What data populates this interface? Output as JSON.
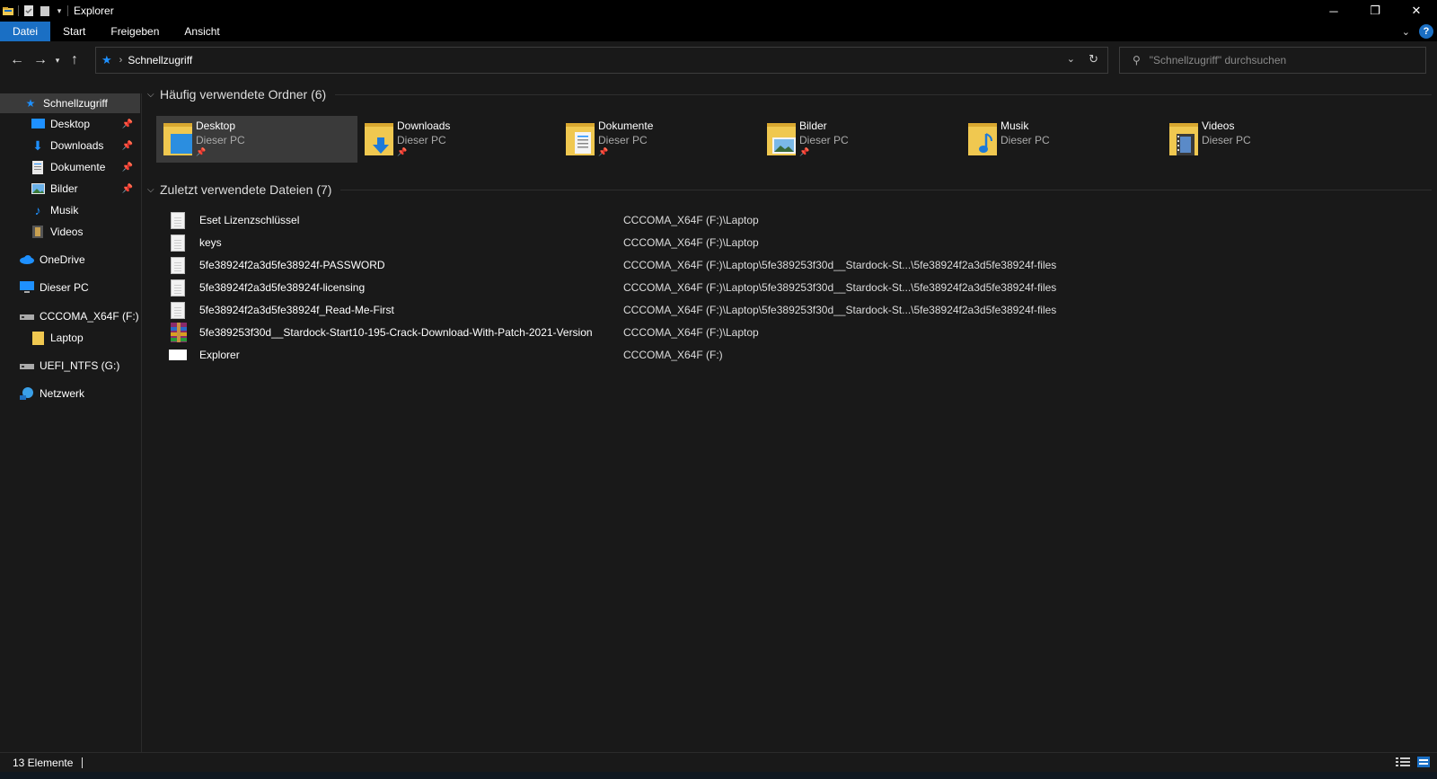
{
  "window": {
    "title": "Explorer"
  },
  "ribbon": {
    "tabs": [
      "Datei",
      "Start",
      "Freigeben",
      "Ansicht"
    ],
    "active": "Datei",
    "help": "?"
  },
  "address": {
    "path": "Schnellzugriff"
  },
  "search": {
    "placeholder": "\"Schnellzugriff\" durchsuchen"
  },
  "sidebar": {
    "items": [
      {
        "label": "Schnellzugriff",
        "icon": "star-icon"
      },
      {
        "label": "Desktop",
        "icon": "desktop-icon",
        "pinned": true
      },
      {
        "label": "Downloads",
        "icon": "download-icon",
        "pinned": true
      },
      {
        "label": "Dokumente",
        "icon": "documents-icon",
        "pinned": true
      },
      {
        "label": "Bilder",
        "icon": "pictures-icon",
        "pinned": true
      },
      {
        "label": "Musik",
        "icon": "music-icon"
      },
      {
        "label": "Videos",
        "icon": "videos-icon"
      },
      {
        "label": "OneDrive",
        "icon": "cloud-icon"
      },
      {
        "label": "Dieser PC",
        "icon": "computer-icon"
      },
      {
        "label": "CCCOMA_X64F (F:)",
        "icon": "drive-icon"
      },
      {
        "label": "Laptop",
        "icon": "folder-icon"
      },
      {
        "label": "UEFI_NTFS (G:)",
        "icon": "drive-icon"
      },
      {
        "label": "Netzwerk",
        "icon": "network-icon"
      }
    ]
  },
  "frequent": {
    "title": "Häufig verwendete Ordner (6)",
    "folders": [
      {
        "name": "Desktop",
        "location": "Dieser PC",
        "pinned": true
      },
      {
        "name": "Downloads",
        "location": "Dieser PC",
        "pinned": true
      },
      {
        "name": "Dokumente",
        "location": "Dieser PC",
        "pinned": true
      },
      {
        "name": "Bilder",
        "location": "Dieser PC",
        "pinned": true
      },
      {
        "name": "Musik",
        "location": "Dieser PC",
        "pinned": false
      },
      {
        "name": "Videos",
        "location": "Dieser PC",
        "pinned": false
      }
    ]
  },
  "recent": {
    "title": "Zuletzt verwendete Dateien (7)",
    "files": [
      {
        "name": "Eset Lizenzschlüssel",
        "location": "CCCOMA_X64F (F:)\\Laptop",
        "icon": "text-file-icon"
      },
      {
        "name": "keys",
        "location": "CCCOMA_X64F (F:)\\Laptop",
        "icon": "text-file-icon"
      },
      {
        "name": "5fe38924f2a3d5fe38924f-PASSWORD",
        "location": "CCCOMA_X64F (F:)\\Laptop\\5fe389253f30d__Stardock-St...\\5fe38924f2a3d5fe38924f-files",
        "icon": "text-file-icon"
      },
      {
        "name": "5fe38924f2a3d5fe38924f-licensing",
        "location": "CCCOMA_X64F (F:)\\Laptop\\5fe389253f30d__Stardock-St...\\5fe38924f2a3d5fe38924f-files",
        "icon": "text-file-icon"
      },
      {
        "name": "5fe38924f2a3d5fe38924f_Read-Me-First",
        "location": "CCCOMA_X64F (F:)\\Laptop\\5fe389253f30d__Stardock-St...\\5fe38924f2a3d5fe38924f-files",
        "icon": "text-file-icon"
      },
      {
        "name": "5fe389253f30d__Stardock-Start10-195-Crack-Download-With-Patch-2021-Version",
        "location": "CCCOMA_X64F (F:)\\Laptop",
        "icon": "archive-icon"
      },
      {
        "name": "Explorer",
        "location": "CCCOMA_X64F (F:)",
        "icon": "blank-file-icon"
      }
    ]
  },
  "status": {
    "count": "13 Elemente"
  },
  "colors": {
    "accent": "#1a6fc4",
    "background": "#191919",
    "selection": "#3a3a3a",
    "folder": "#f0c850"
  }
}
